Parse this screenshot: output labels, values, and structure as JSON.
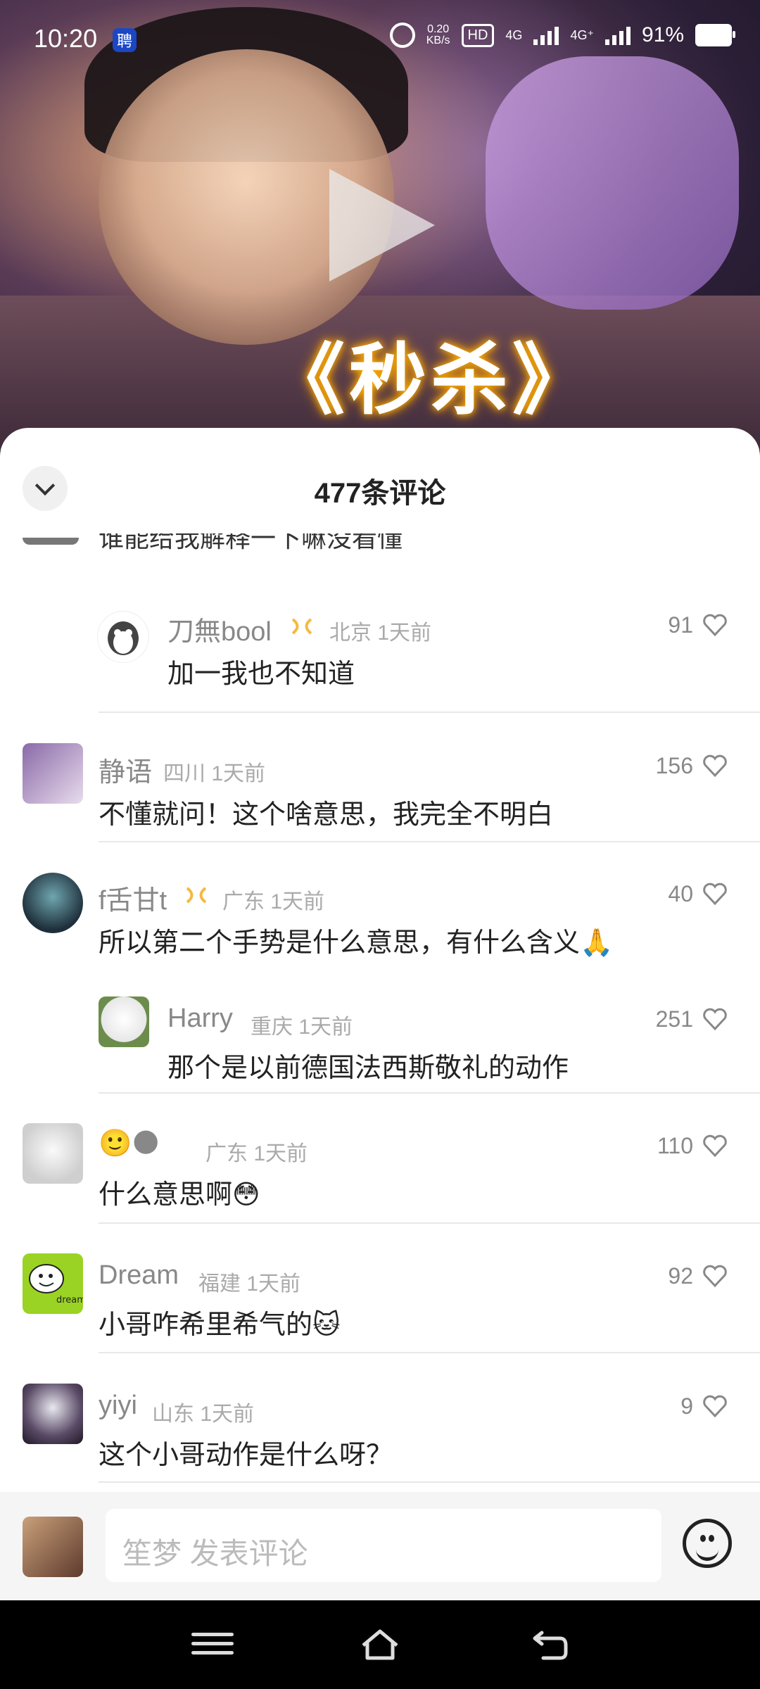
{
  "status_bar": {
    "time": "10:20",
    "time_badge": "聘",
    "speed_value": "0.20",
    "speed_unit": "KB/s",
    "hd": "HD",
    "network1": "4G",
    "network2": "4G⁺",
    "battery_percent": "91%"
  },
  "video": {
    "title_text": "《秒杀》"
  },
  "sheet": {
    "title": "477条评论",
    "cut_text": "谁能给我解释一下嘛没看懂"
  },
  "comments": [
    {
      "id": "c1",
      "username": "刀無bool",
      "has_badge": true,
      "location": "北京",
      "time": "1天前",
      "text": "加一我也不知道",
      "likes": "91",
      "reply": true
    },
    {
      "id": "c2",
      "username": "静语",
      "has_badge": false,
      "location": "四川",
      "time": "1天前",
      "text": "不懂就问！这个啥意思，我完全不明白",
      "likes": "156",
      "reply": false
    },
    {
      "id": "c3",
      "username": "f舌甘t",
      "has_badge": true,
      "location": "广东",
      "time": "1天前",
      "text": "所以第二个手势是什么意思，有什么含义🙏",
      "likes": "40",
      "reply": false
    },
    {
      "id": "c4",
      "username": "Harry",
      "has_badge": false,
      "location": "重庆",
      "time": "1天前",
      "text": "那个是以前德国法西斯敬礼的动作",
      "likes": "251",
      "reply": true
    },
    {
      "id": "c5",
      "username": "🙂🌑",
      "has_badge": false,
      "location": "广东",
      "time": "1天前",
      "text": "什么意思啊😳",
      "likes": "110",
      "reply": false
    },
    {
      "id": "c6",
      "username": "Dream",
      "has_badge": false,
      "location": "福建",
      "time": "1天前",
      "text": "小哥咋希里希气的🐱",
      "likes": "92",
      "reply": false
    },
    {
      "id": "c7",
      "username": "yiyi",
      "has_badge": false,
      "location": "山东",
      "time": "1天前",
      "text": "这个小哥动作是什么呀？",
      "likes": "9",
      "reply": false
    }
  ],
  "input_bar": {
    "placeholder": "笙梦 发表评论"
  },
  "avatar_labels": {
    "dream": "dream"
  },
  "icons": {
    "collapse": "chevron-down-icon",
    "heart": "heart-icon",
    "emoji": "emoji-icon",
    "menu": "menu-icon",
    "home": "home-icon",
    "back": "back-icon"
  }
}
